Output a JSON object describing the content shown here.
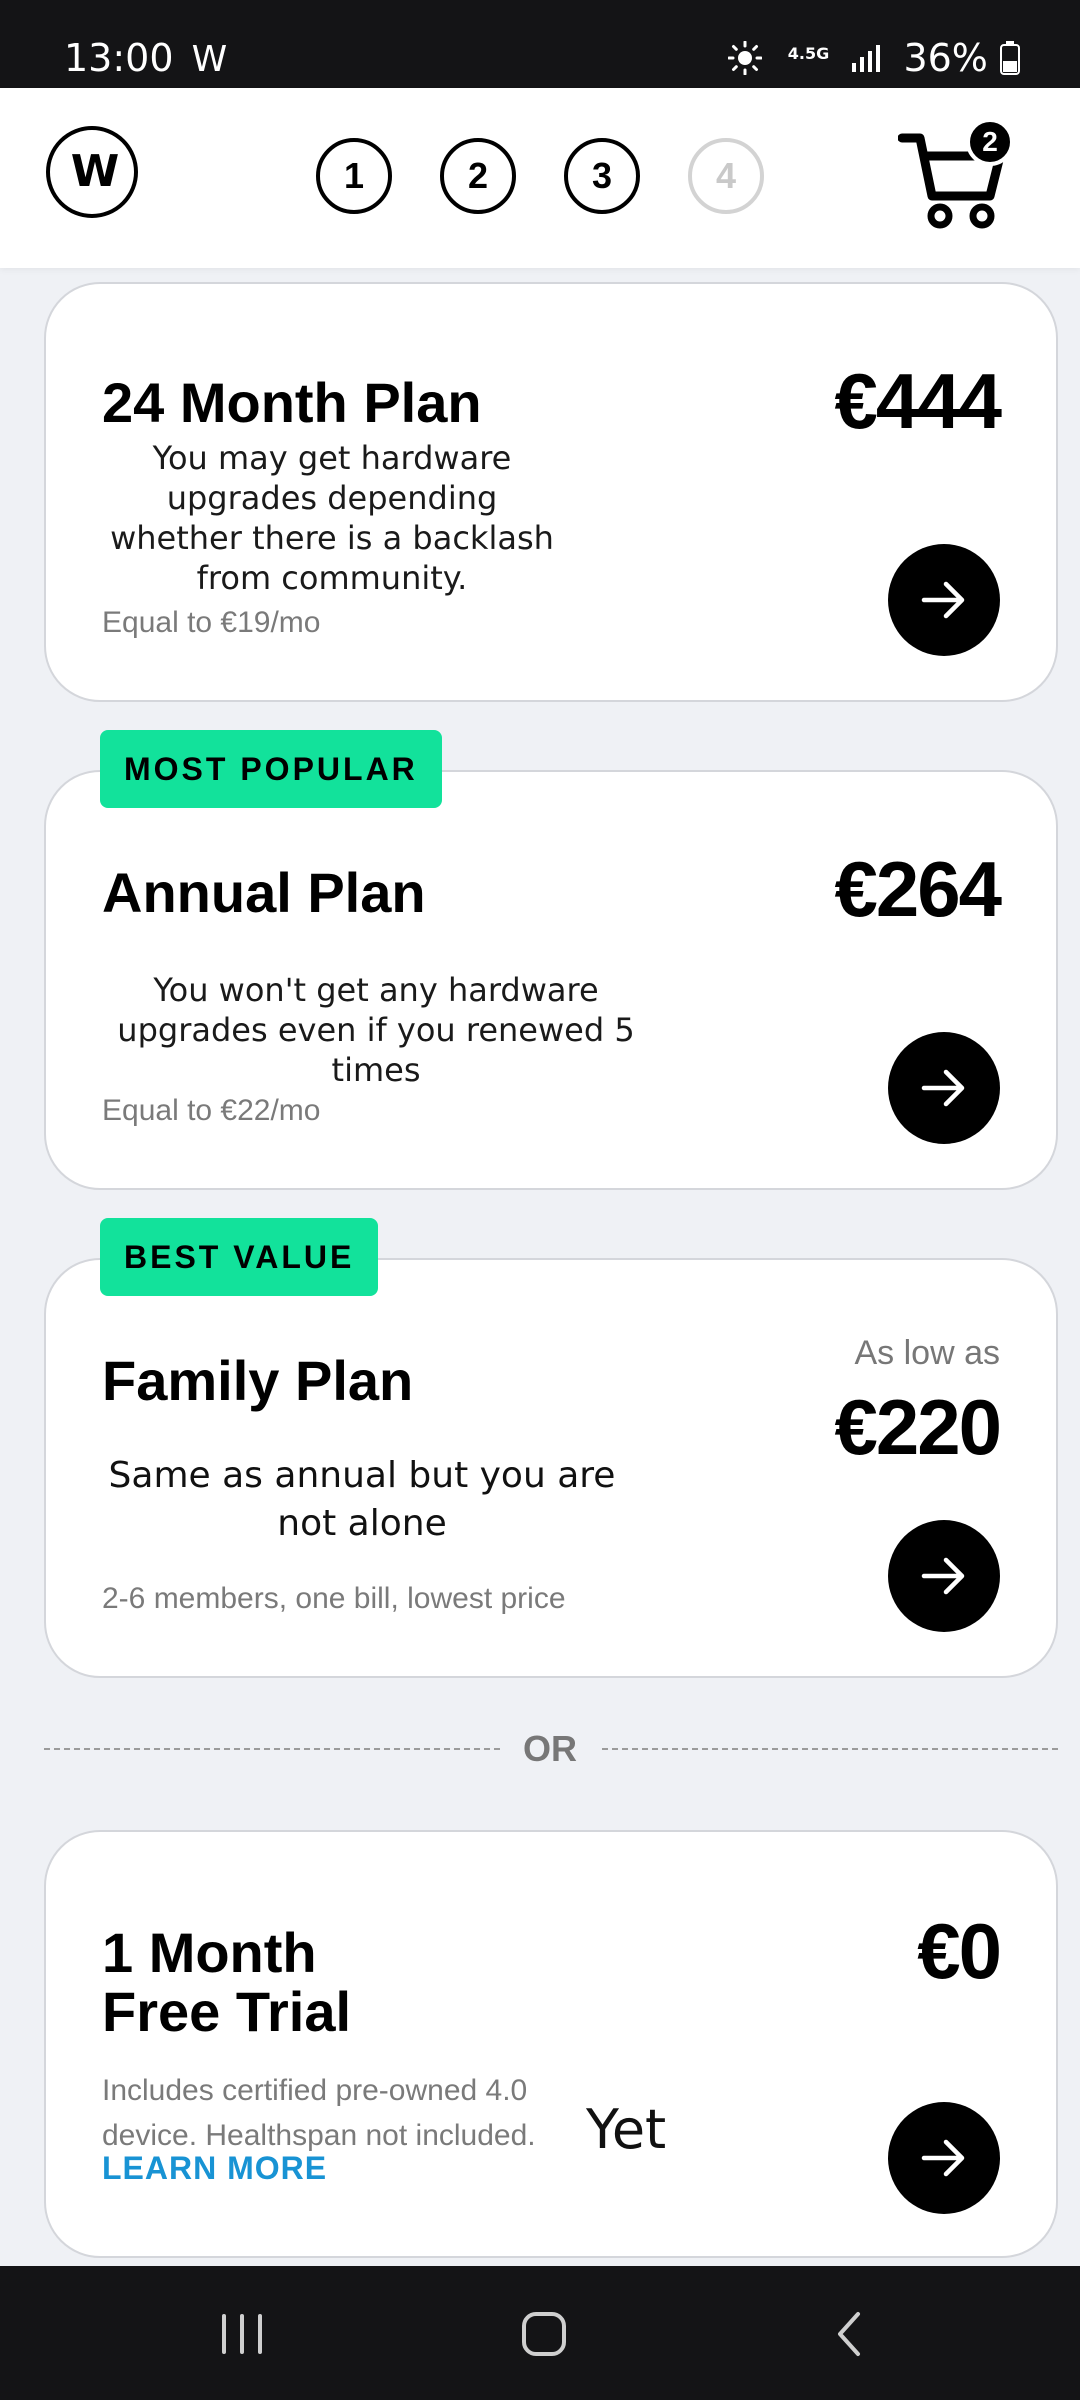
{
  "status_bar": {
    "time": "13:00",
    "carrier_icon_text": "W",
    "network": "4.5G",
    "battery": "36%"
  },
  "header": {
    "logo_text": "W",
    "steps": [
      "1",
      "2",
      "3",
      "4"
    ],
    "active_steps": 3,
    "cart_count": "2"
  },
  "plans": [
    {
      "title": "24 Month Plan",
      "description": "You may get hardware upgrades depending whether there is a backlash from community.",
      "subtext": "Equal to €19/mo",
      "price": "€444"
    },
    {
      "tag": "MOST POPULAR",
      "title": "Annual Plan",
      "description": "You won't get any hardware upgrades even if you renewed 5 times",
      "subtext": "Equal to €22/mo",
      "price": "€264"
    },
    {
      "tag": "BEST VALUE",
      "title": "Family Plan",
      "description": "Same as annual but you are not alone",
      "subtext": "2-6 members, one bill, lowest price",
      "price_prefix": "As low as",
      "price": "€220"
    }
  ],
  "divider_text": "OR",
  "trial": {
    "title_line1": "1 Month",
    "title_line2": "Free Trial",
    "price": "€0",
    "subtext_line1": "Includes certified pre-owned 4.0",
    "subtext_line2": "device. Healthspan not included.",
    "overlay_text": "Yet",
    "learn_more": "LEARN MORE"
  },
  "colors": {
    "accent_tag": "#12e29b",
    "link": "#1893d4",
    "background": "#eff1f5"
  }
}
